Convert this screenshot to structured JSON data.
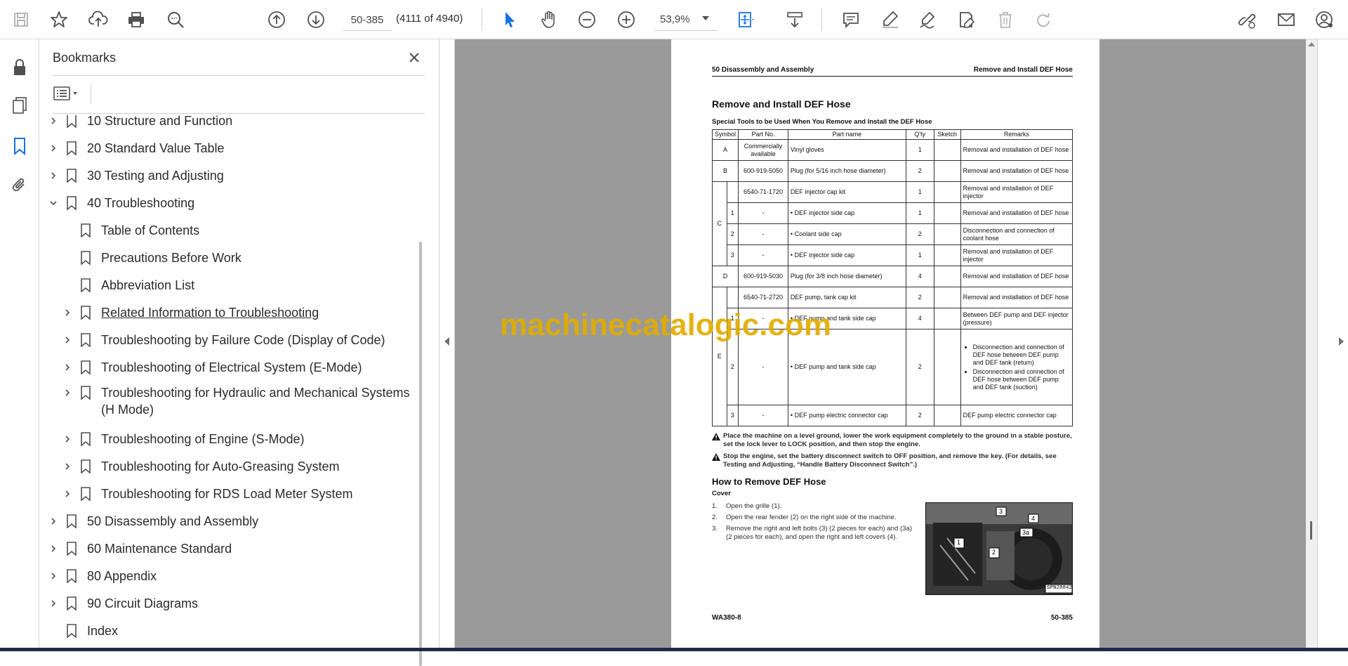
{
  "toolbar": {
    "page_value": "50-385",
    "page_count": "(4111 of 4940)",
    "zoom_value": "53,9%"
  },
  "bookmarks": {
    "title": "Bookmarks",
    "items": [
      {
        "label": "10 Structure and Function"
      },
      {
        "label": "20 Standard Value Table"
      },
      {
        "label": "30 Testing and Adjusting"
      },
      {
        "label": "40 Troubleshooting"
      },
      {
        "label": "Table of Contents"
      },
      {
        "label": "Precautions Before Work"
      },
      {
        "label": "Abbreviation List"
      },
      {
        "label": "Related Information to Troubleshooting"
      },
      {
        "label": "Troubleshooting by Failure Code (Display of Code)"
      },
      {
        "label": "Troubleshooting of Electrical System (E-Mode)"
      },
      {
        "label": "Troubleshooting for Hydraulic and Mechanical Systems (H Mode)"
      },
      {
        "label": "Troubleshooting of Engine (S-Mode)"
      },
      {
        "label": "Troubleshooting for Auto-Greasing System"
      },
      {
        "label": "Troubleshooting for RDS Load Meter System"
      },
      {
        "label": "50 Disassembly and Assembly"
      },
      {
        "label": "60 Maintenance Standard"
      },
      {
        "label": "80 Appendix"
      },
      {
        "label": "90 Circuit Diagrams"
      },
      {
        "label": "Index"
      }
    ]
  },
  "document": {
    "header_left": "50 Disassembly and Assembly",
    "header_right": "Remove and Install DEF Hose",
    "title": "Remove and Install DEF Hose",
    "subtitle": "Special Tools to be Used When You Remove and Install the DEF Hose",
    "table": {
      "headers": [
        "Symbol",
        "Part No.",
        "Part name",
        "Q'ty",
        "Sketch",
        "Remarks"
      ],
      "rows": {
        "a": {
          "sym": "A",
          "part": "Commercially available",
          "name": "Vinyl gloves",
          "qty": "1",
          "rem": "Removal and installation of DEF hose"
        },
        "b": {
          "sym": "B",
          "part": "600-919-5050",
          "name": "Plug (for 5/16 inch hose diameter)",
          "qty": "2",
          "rem": "Removal and installation of DEF hose"
        },
        "c0": {
          "sym": "C",
          "part": "6540-71-1720",
          "name": "DEF injector cap kit",
          "qty": "1",
          "rem": "Removal and installation of DEF injector"
        },
        "c1": {
          "sub": "1",
          "part": "-",
          "name": "DEF injector side cap",
          "qty": "1",
          "rem": "Removal and installation of DEF hose"
        },
        "c2": {
          "sub": "2",
          "part": "-",
          "name": "Coolant side cap",
          "qty": "2",
          "rem": "Disconnection and connection of coolant hose"
        },
        "c3": {
          "sub": "3",
          "part": "-",
          "name": "DEF injector side cap",
          "qty": "1",
          "rem": "Removal and installation of DEF injector"
        },
        "d": {
          "sym": "D",
          "part": "600-919-5030",
          "name": "Plug (for 3/8 inch hose diameter)",
          "qty": "4",
          "rem": "Removal and installation of DEF hose"
        },
        "e0": {
          "sym": "E",
          "part": "6540-71-2720",
          "name": "DEF pump, tank cap kit",
          "qty": "2",
          "rem": "Removal and installation of DEF hose"
        },
        "e1": {
          "sub": "1",
          "part": "-",
          "name": "DEF pump and tank side cap",
          "qty": "4",
          "rem": "Between DEF pump and DEF injector (pressure)"
        },
        "e2": {
          "sub": "2",
          "part": "-",
          "name": "DEF pump and tank side cap",
          "qty": "2",
          "rem1": "Disconnection and connection of DEF hose between DEF pump and DEF tank (return)",
          "rem2": "Disconnection and connection of DEF hose between DEF pump and DEF tank (suction)"
        },
        "e3": {
          "sub": "3",
          "part": "-",
          "name": "DEF pump electric connector cap",
          "qty": "2",
          "rem": "DEF pump electric connector cap"
        }
      }
    },
    "warnings": [
      "Place the machine on a level ground, lower the work equipment completely to the ground in a stable posture, set the lock lever to LOCK position, and then stop the engine.",
      "Stop the engine, set the battery disconnect switch to OFF position, and remove the key. (For details, see Testing and Adjusting, “Handle Battery Disconnect Switch”.)"
    ],
    "section": "How to Remove DEF Hose",
    "subsection": "Cover",
    "steps": [
      {
        "n": "1.",
        "text": "Open the grille (1)."
      },
      {
        "n": "2.",
        "text": "Open the rear fender (2) on the right side of the machine."
      },
      {
        "n": "3.",
        "text": "Remove the right and left bolts (3) (2 pieces for each) and (3a) (2 pieces for each), and open the right and left covers (4)."
      }
    ],
    "photo_code": "SPN28842",
    "photo_callouts": [
      "1",
      "2",
      "3",
      "3a",
      "4"
    ],
    "footer_left": "WA380-8",
    "footer_right": "50-385"
  },
  "watermark": "machinecatalogic.com",
  "colors": {
    "accent": "#1473e6",
    "watermark": "#e1ad00",
    "viewport_bg": "#9a9a9a"
  }
}
